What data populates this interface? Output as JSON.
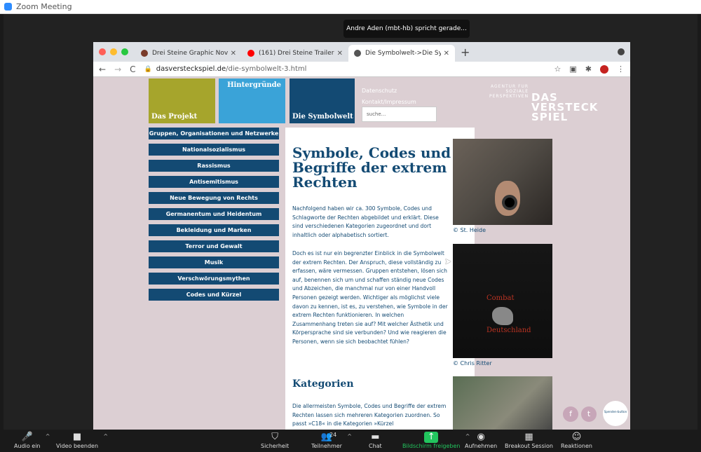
{
  "zoom": {
    "window_title": "Zoom Meeting",
    "speaker_banner": "Andre Aden (mbt-hb) spricht gerade...",
    "toolbar": [
      {
        "label": "Audio ein",
        "icon": "mic-muted-icon",
        "carat": true
      },
      {
        "label": "Video beenden",
        "icon": "video-camera-icon",
        "carat": true
      },
      {
        "label": "Sicherheit",
        "icon": "shield-icon"
      },
      {
        "label": "Teilnehmer",
        "icon": "participants-icon",
        "count": "24",
        "carat": true
      },
      {
        "label": "Chat",
        "icon": "chat-icon"
      },
      {
        "label": "Bildschirm freigeben",
        "icon": "share-screen-icon",
        "carat": true,
        "color": "#22c55e"
      },
      {
        "label": "Aufnehmen",
        "icon": "record-icon"
      },
      {
        "label": "Breakout Session",
        "icon": "breakout-icon"
      },
      {
        "label": "Reaktionen",
        "icon": "emoji-icon"
      }
    ]
  },
  "browser": {
    "tabs": [
      {
        "title": "Drei Steine Graphic Novel geg·",
        "favicon": "#7a3b2a"
      },
      {
        "title": "(161) Drei Steine Trailer :: - You",
        "favicon": "#ff0000"
      },
      {
        "title": "Die Symbolwelt->Die Symbolw",
        "favicon": "#555555",
        "active": true
      }
    ],
    "url_host": "dasversteckspiel.de",
    "url_path": "/die-symbolwelt-3.html"
  },
  "site": {
    "header": {
      "projekt": "Das Projekt",
      "hintergruende": "Hintergründe",
      "symbolwelt": "Die Symbolwelt",
      "datenschutz": "Datenschutz",
      "kontakt": "Kontakt/Impressum",
      "search_placeholder": "suche..."
    },
    "logo": {
      "line1": "AGENTUR FÜR",
      "line2": "SOZIALE",
      "line3": "PERSPEKTIVEN",
      "big1": "DAS",
      "big2": "VERSTECK",
      "big3": "SPIEL"
    },
    "nav": [
      "Gruppen, Organisationen und Netzwerke",
      "Nationalsozialismus",
      "Rassismus",
      "Antisemitismus",
      "Neue Bewegung von Rechts",
      "Germanentum und Heidentum",
      "Bekleidung und Marken",
      "Terror und Gewalt",
      "Musik",
      "Verschwörungsmythen",
      "Codes und Kürzel"
    ],
    "title": "Symbole, Codes und Begriffe der extrem Rechten",
    "para1": "Nachfolgend haben wir ca. 300 Symbole, Codes und Schlagworte der Rechten abgebildet und erklärt. Diese sind verschiedenen Kategorien zugeordnet und dort inhaltlich oder alphabetisch sortiert.",
    "para2": "Doch es ist nur ein begrenzter Einblick in die Symbolwelt der extrem Rechten. Der Anspruch, diese vollständig zu erfassen, wäre vermessen. Gruppen entstehen, lösen sich auf, benennen sich um und schaffen ständig neue Codes und Abzeichen, die manchmal nur von einer Handvoll Personen gezeigt werden. Wichtiger als möglichst viele davon zu kennen, ist es, zu verstehen, wie Symbole in der extrem Rechten funktionieren. In welchen Zusammenhang treten sie auf? Mit welcher Ästhetik und Körpersprache sind sie verbunden? Und wie reagieren die Personen, wenn sie sich beobachtet fühlen?",
    "kategorien_heading": "Kategorien",
    "para3": "Die allermeisten Symbole, Codes und Begriffe der extrem Rechten lassen sich mehreren Kategorien zuordnen. So passt »C18« in die Kategorien »Kürzel",
    "caption1": "© St. Heide",
    "caption2": "© Chris Ritter",
    "shirt_text1": "Combat",
    "shirt_text2": "Deutschland",
    "spenden": "Spenden-button"
  }
}
